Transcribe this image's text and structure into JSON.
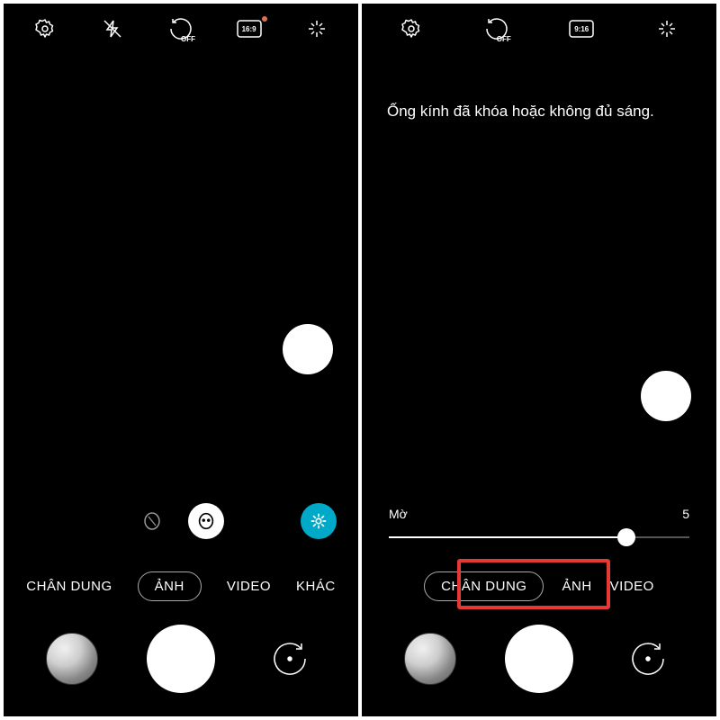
{
  "left": {
    "topbar": {
      "settings_icon": "settings",
      "flash_icon": "flash-off",
      "timer_icon": "timer-off",
      "timer_text": "OFF",
      "ratio_icon": "aspect-ratio",
      "ratio_text": "16:9",
      "sparkle_icon": "beautify"
    },
    "modes": [
      "CHÂN DUNG",
      "ẢNH",
      "VIDEO",
      "KHÁC"
    ],
    "selected_mode_index": 1,
    "bottom": {
      "gallery": "gallery-thumbnail",
      "shutter": "shutter",
      "switch": "switch-camera"
    }
  },
  "right": {
    "topbar": {
      "settings_icon": "settings",
      "timer_icon": "timer-off",
      "timer_text": "OFF",
      "ratio_icon": "aspect-ratio",
      "ratio_text": "9:16",
      "sparkle_icon": "beautify"
    },
    "message": "Ống kính đã khóa hoặc không đủ sáng.",
    "slider": {
      "label_left": "Mờ",
      "label_right": "5",
      "value": 5,
      "min": 0,
      "max": 7,
      "percent": 79
    },
    "modes": [
      "CHÂN DUNG",
      "ẢNH",
      "VIDEO"
    ],
    "selected_mode_index": 0,
    "highlighted_mode_index": 0,
    "bottom": {
      "gallery": "gallery-thumbnail",
      "shutter": "shutter",
      "switch": "switch-camera"
    }
  }
}
